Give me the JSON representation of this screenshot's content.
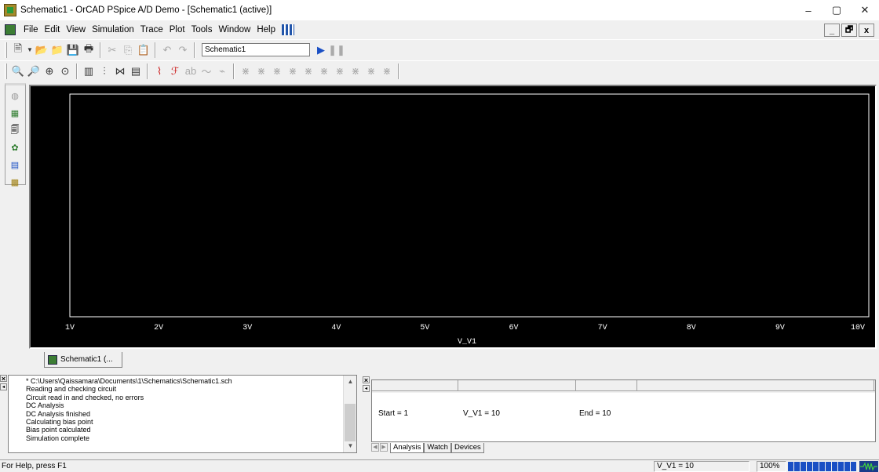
{
  "window": {
    "title": "Schematic1 - OrCAD PSpice A/D Demo - [Schematic1 (active)]",
    "controls": [
      "–",
      "▢",
      "✕"
    ]
  },
  "menubar": {
    "items": [
      {
        "label": "File",
        "accel": "F"
      },
      {
        "label": "Edit",
        "accel": "E"
      },
      {
        "label": "View",
        "accel": "V"
      },
      {
        "label": "Simulation",
        "accel": "S"
      },
      {
        "label": "Trace",
        "accel": "T"
      },
      {
        "label": "Plot",
        "accel": "P"
      },
      {
        "label": "Tools",
        "accel": "o"
      },
      {
        "label": "Window",
        "accel": "W"
      },
      {
        "label": "Help",
        "accel": "H"
      }
    ],
    "mdi_controls": [
      "_",
      "🗗",
      "x"
    ]
  },
  "toolbar": {
    "profile_combo": "Schematic1"
  },
  "plot": {
    "background": "#000000",
    "axis_color": "#ffffff",
    "x_ticks": [
      "1V",
      "2V",
      "3V",
      "4V",
      "5V",
      "6V",
      "7V",
      "8V",
      "9V",
      "10V"
    ],
    "xlabel": "V_V1"
  },
  "doc_tab": {
    "label": "Schematic1 (..."
  },
  "session_log": {
    "lines": [
      "* C:\\Users\\Qaissamara\\Documents\\1\\Schematics\\Schematic1.sch",
      "Reading and checking circuit",
      "Circuit read in and checked, no errors",
      "DC Analysis",
      "DC Analysis finished",
      "Calculating bias point",
      "Bias point calculated",
      "Simulation complete"
    ]
  },
  "probe_panel": {
    "start": "Start = 1",
    "sweep": "V_V1 =  10",
    "end": "End = 10"
  },
  "bottom_tabs": [
    "Analysis",
    "Watch",
    "Devices"
  ],
  "statusbar": {
    "help": "For Help, press F1",
    "sweep_value": "V_V1 =  10",
    "percent": "100%",
    "progress_fraction": 1.0,
    "accent": "#1a4fc4"
  }
}
